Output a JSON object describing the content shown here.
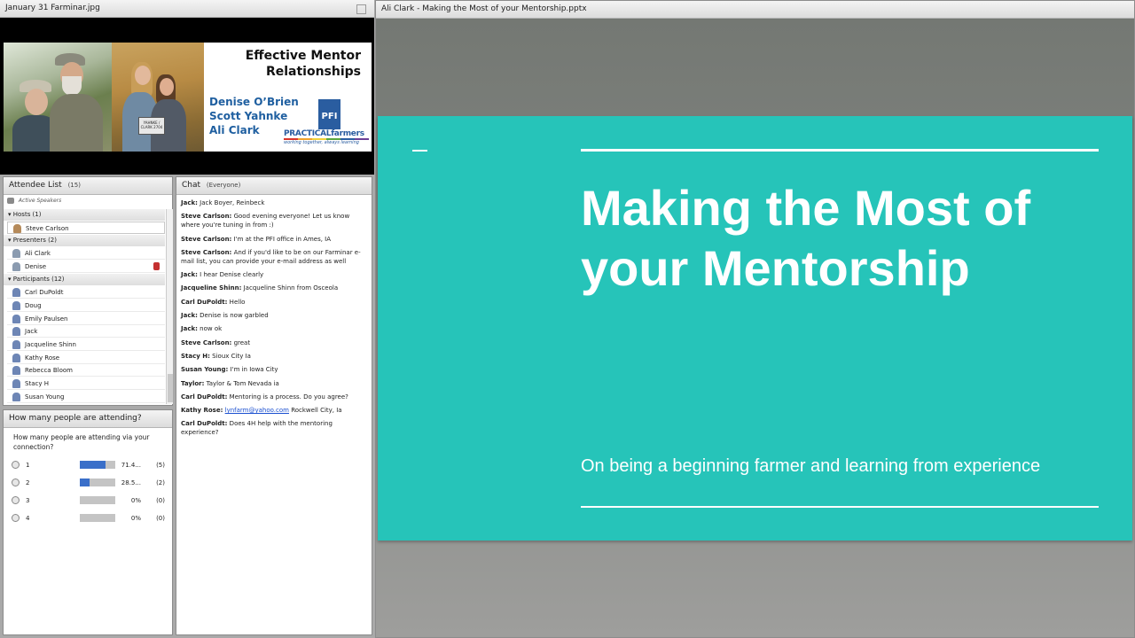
{
  "image_panel": {
    "title": "January 31 Farminar.jpg",
    "banner": {
      "title_line1": "Effective Mentor",
      "title_line2": "Relationships",
      "names": [
        "Denise O’Brien",
        "Scott Yahnke",
        "Ali Clark"
      ],
      "logo_mark": "PFI",
      "logo_text": "PRACTICALfarmers",
      "logo_tagline": "working together, always learning",
      "mailbox_text": "YAHNKE / CLARK 2704"
    }
  },
  "attendee_list": {
    "title": "Attendee List",
    "count": "(15)",
    "active_speakers": "Active Speakers",
    "hosts_label": "Hosts (1)",
    "hosts": [
      "Steve Carlson"
    ],
    "presenters_label": "Presenters (2)",
    "presenters": [
      "Ali Clark",
      "Denise"
    ],
    "participants_label": "Participants (12)",
    "participants": [
      "Carl DuPoldt",
      "Doug",
      "Emily Paulsen",
      "Jack",
      "Jacqueline Shinn",
      "Kathy Rose",
      "Rebecca Bloom",
      "Stacy H",
      "Susan Young"
    ]
  },
  "poll": {
    "title": "How many people are attending?",
    "question": "How many people are attending via your connection?",
    "options": [
      {
        "label": "1",
        "pct": "71.4...",
        "count": "(5)",
        "fraction": 0.714
      },
      {
        "label": "2",
        "pct": "28.5...",
        "count": "(2)",
        "fraction": 0.285
      },
      {
        "label": "3",
        "pct": "0%",
        "count": "(0)",
        "fraction": 0
      },
      {
        "label": "4",
        "pct": "0%",
        "count": "(0)",
        "fraction": 0
      }
    ]
  },
  "chat": {
    "title": "Chat",
    "scope": "(Everyone)",
    "messages": [
      {
        "who": "Jack:",
        "text": " Jack Boyer, Reinbeck"
      },
      {
        "who": "Steve Carlson:",
        "text": " Good evening everyone! Let us know where you're tuning in from :)"
      },
      {
        "who": "Steve Carlson:",
        "text": " I'm at the PFI office in Ames, IA"
      },
      {
        "who": "Steve Carlson:",
        "text": " And if you'd like to be on our Farminar e-mail list, you can provide your e-mail address as well"
      },
      {
        "who": "Jack:",
        "text": " I hear Denise clearly"
      },
      {
        "who": "Jacqueline Shinn:",
        "text": " Jacqueline Shinn from Osceola"
      },
      {
        "who": "Carl DuPoldt:",
        "text": " Hello"
      },
      {
        "who": "Jack:",
        "text": " Denise is now garbled"
      },
      {
        "who": "Jack:",
        "text": " now ok"
      },
      {
        "who": "Steve Carlson:",
        "text": " great"
      },
      {
        "who": "Stacy H:",
        "text": " Sioux City Ia"
      },
      {
        "who": "Susan Young:",
        "text": " I'm in Iowa City"
      },
      {
        "who": "Taylor:",
        "text": " Taylor & Tom Nevada ia"
      },
      {
        "who": "Carl DuPoldt:",
        "text": " Mentoring is a process. Do you agree?"
      },
      {
        "who": "Kathy Rose:",
        "text": " Rockwell City, Ia",
        "link": "lynfarm@yahoo.com"
      },
      {
        "who": "Carl DuPoldt:",
        "text": " Does 4H help with the mentoring experience?"
      }
    ]
  },
  "slide_panel": {
    "title": "Ali Clark - Making the Most of your Mentorship.pptx",
    "slide_title_line1": "Making the Most of",
    "slide_title_line2": "your Mentorship",
    "slide_subtitle": "On being a beginning farmer and learning from experience",
    "slide_color": "#26c4b9"
  }
}
